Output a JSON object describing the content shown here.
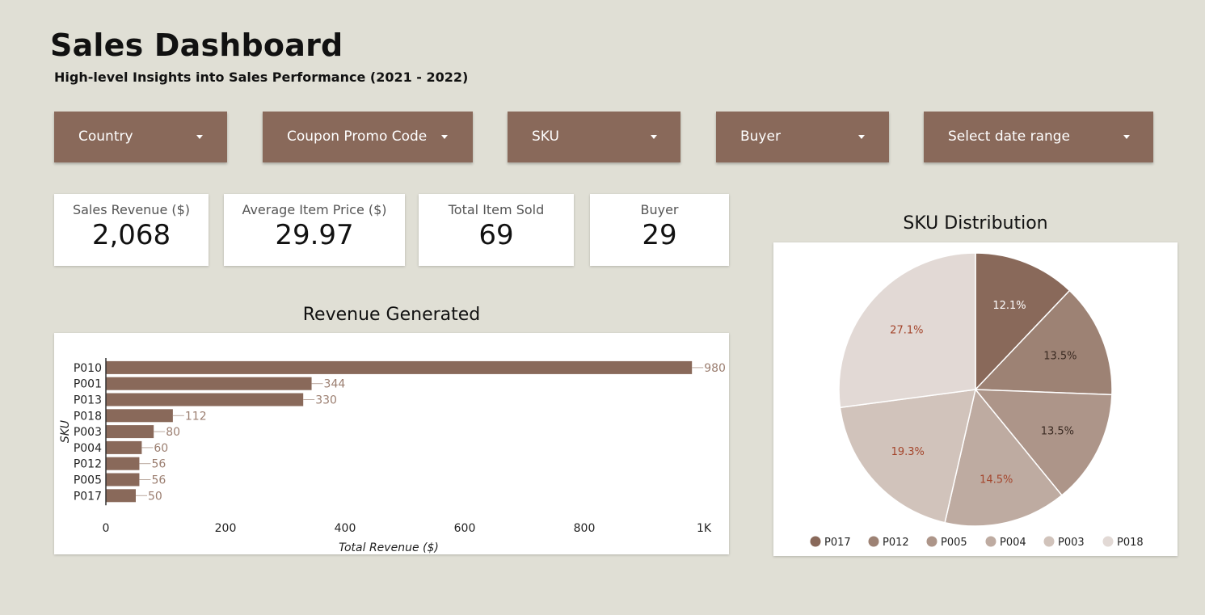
{
  "header": {
    "title": "Sales Dashboard",
    "subtitle": "High-level Insights into Sales Performance (2021 - 2022)"
  },
  "filters": [
    {
      "label": "Country"
    },
    {
      "label": "Coupon Promo Code"
    },
    {
      "label": "SKU"
    },
    {
      "label": "Buyer"
    },
    {
      "label": "Select date range"
    }
  ],
  "kpis": [
    {
      "label": "Sales Revenue ($)",
      "value": "2,068"
    },
    {
      "label": "Average Item Price ($)",
      "value": "29.97"
    },
    {
      "label": "Total Item Sold",
      "value": "69"
    },
    {
      "label": "Buyer",
      "value": "29"
    }
  ],
  "colors": {
    "accent": "#89695a",
    "background": "#e0dfd5",
    "pie": [
      "#89695a",
      "#9d8274",
      "#ad9589",
      "#beaba1",
      "#d1c3bb",
      "#e2d9d5"
    ]
  },
  "chart_data": [
    {
      "type": "bar",
      "orientation": "horizontal",
      "title": "Revenue Generated",
      "xlabel": "Total Revenue ($)",
      "ylabel": "SKU",
      "categories": [
        "P010",
        "P001",
        "P013",
        "P018",
        "P003",
        "P004",
        "P012",
        "P005",
        "P017"
      ],
      "values": [
        980,
        344,
        330,
        112,
        80,
        60,
        56,
        56,
        50
      ],
      "xlim": [
        0,
        1000
      ],
      "xticks": [
        "0",
        "200",
        "400",
        "600",
        "800",
        "1K"
      ],
      "data_labels": true
    },
    {
      "type": "pie",
      "title": "SKU Distribution",
      "labels": [
        "P017",
        "P012",
        "P005",
        "P004",
        "P003",
        "P018"
      ],
      "values": [
        12.1,
        13.5,
        13.5,
        14.5,
        19.3,
        27.1
      ],
      "value_labels": [
        "12.1%",
        "13.5%",
        "13.5%",
        "14.5%",
        "19.3%",
        "27.1%"
      ],
      "legend_position": "bottom"
    }
  ]
}
